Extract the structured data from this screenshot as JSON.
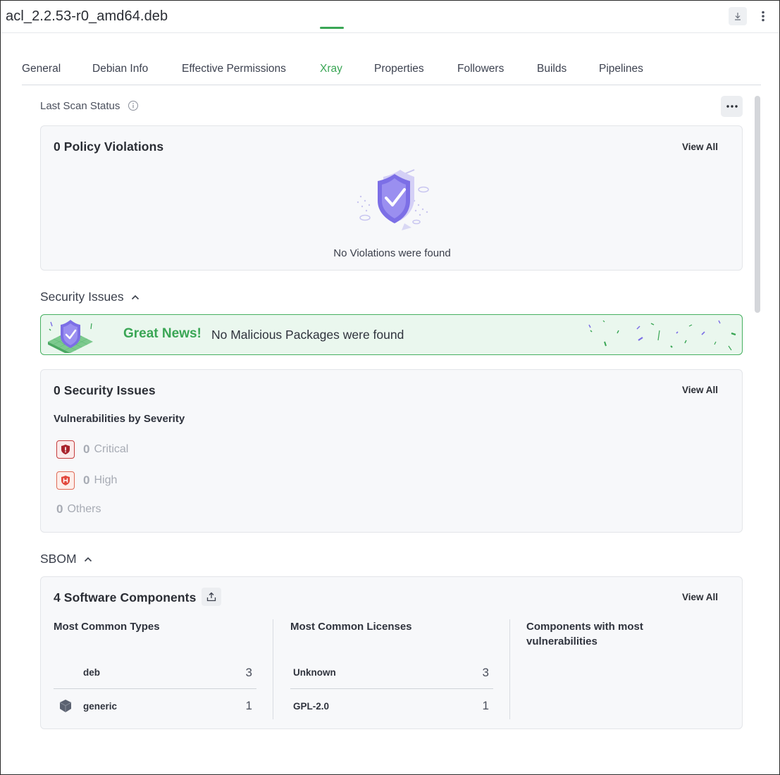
{
  "window": {
    "title": "acl_2.2.53-r0_amd64.deb"
  },
  "tabs": [
    {
      "label": "General"
    },
    {
      "label": "Debian Info"
    },
    {
      "label": "Effective Permissions"
    },
    {
      "label": "Xray",
      "active": true
    },
    {
      "label": "Properties"
    },
    {
      "label": "Followers"
    },
    {
      "label": "Builds"
    },
    {
      "label": "Pipelines"
    }
  ],
  "scan": {
    "label": "Last Scan Status"
  },
  "violations": {
    "title": "0 Policy Violations",
    "view_all": "View All",
    "empty_text": "No Violations were found"
  },
  "security": {
    "header": "Security Issues",
    "news_great": "Great News!",
    "news_text": "No Malicious Packages were found",
    "title": "0 Security Issues",
    "view_all": "View All",
    "severity_heading": "Vulnerabilities by Severity",
    "critical_count": "0",
    "critical_label": "Critical",
    "high_count": "0",
    "high_label": "High",
    "others_count": "0",
    "others_label": "Others"
  },
  "sbom": {
    "header": "SBOM",
    "title": "4 Software Components",
    "view_all": "View All",
    "types_title": "Most Common Types",
    "types": [
      {
        "label": "deb",
        "count": "3"
      },
      {
        "label": "generic",
        "count": "1"
      }
    ],
    "licenses_title": "Most Common Licenses",
    "licenses": [
      {
        "label": "Unknown",
        "count": "3"
      },
      {
        "label": "GPL-2.0",
        "count": "1"
      }
    ],
    "vuln_title": "Components with most vulnerabilities"
  },
  "colors": {
    "accent": "#3aa655",
    "critical": "#c53b3b",
    "high": "#e06a55"
  }
}
